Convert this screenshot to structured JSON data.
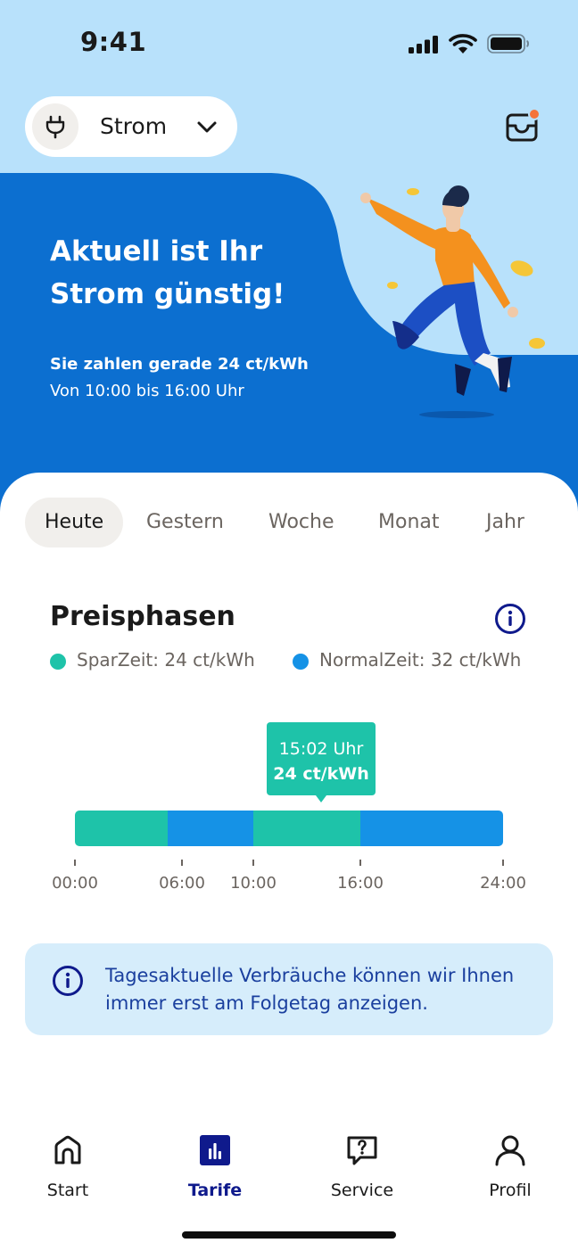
{
  "status_bar": {
    "time": "9:41"
  },
  "header": {
    "selector_label": "Strom",
    "plug_icon": "plug-icon",
    "inbox_icon": "inbox-icon"
  },
  "hero": {
    "title_line1": "Aktuell ist Ihr",
    "title_line2": "Strom günstig!",
    "price_line": "Sie zahlen gerade 24 ct/kWh",
    "time_line": "Von 10:00 bis 16:00 Uhr"
  },
  "tabs": [
    {
      "label": "Heute",
      "active": true
    },
    {
      "label": "Gestern",
      "active": false
    },
    {
      "label": "Woche",
      "active": false
    },
    {
      "label": "Monat",
      "active": false
    },
    {
      "label": "Jahr",
      "active": false
    }
  ],
  "section": {
    "title": "Preisphasen",
    "info_icon": "info-icon"
  },
  "legend": [
    {
      "label": "SparZeit: 24 ct/kWh",
      "color": "#1ec3a9"
    },
    {
      "label": "NormalZeit: 32 ct/kWh",
      "color": "#1592e6"
    }
  ],
  "chart_data": {
    "type": "bar",
    "segments": [
      {
        "start": 0,
        "end": 5.2,
        "phase": "SparZeit"
      },
      {
        "start": 5.2,
        "end": 10,
        "phase": "NormalZeit"
      },
      {
        "start": 10,
        "end": 16,
        "phase": "SparZeit"
      },
      {
        "start": 16,
        "end": 24,
        "phase": "NormalZeit"
      }
    ],
    "ticks": [
      {
        "value": 0,
        "label": "00:00"
      },
      {
        "value": 6,
        "label": "06:00"
      },
      {
        "value": 10,
        "label": "10:00"
      },
      {
        "value": 16,
        "label": "16:00"
      },
      {
        "value": 24,
        "label": "24:00"
      }
    ],
    "xlim": [
      0,
      24
    ],
    "current": {
      "value": 13.8,
      "time_label": "15:02 Uhr",
      "price_label": "24 ct/kWh"
    },
    "colors": {
      "SparZeit": "#1ec3a9",
      "NormalZeit": "#1592e6"
    }
  },
  "notice": {
    "text": "Tagesaktuelle Verbräuche können wir Ihnen immer erst am Folgetag anzeigen.",
    "icon": "info-icon"
  },
  "nav": [
    {
      "label": "Start",
      "icon": "home-icon",
      "active": false
    },
    {
      "label": "Tarife",
      "icon": "tariff-chart-icon",
      "active": true
    },
    {
      "label": "Service",
      "icon": "service-chat-icon",
      "active": false
    },
    {
      "label": "Profil",
      "icon": "profile-icon",
      "active": false
    }
  ],
  "colors": {
    "hero_light": "#b8e1fb",
    "hero_dark": "#0c6fd0",
    "accent_navy": "#0f1a8c",
    "notice_bg": "#d6edfb"
  }
}
